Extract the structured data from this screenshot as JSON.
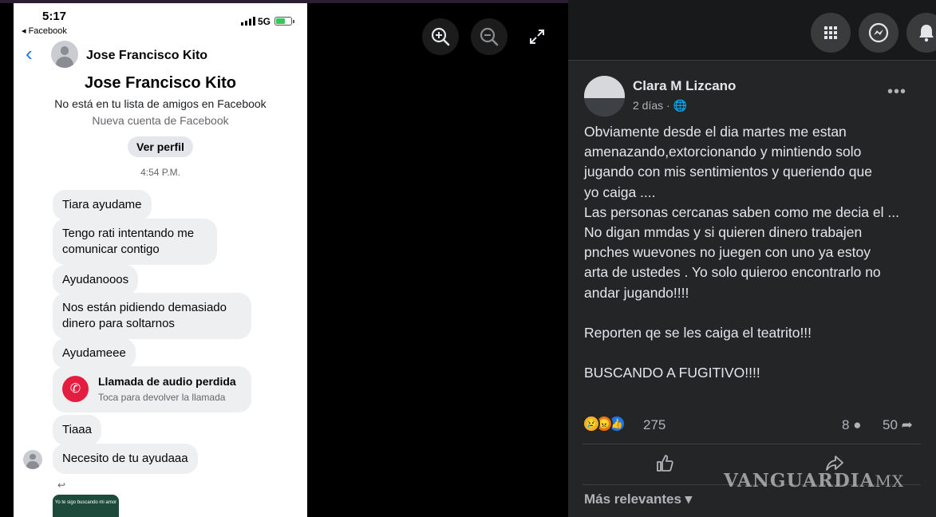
{
  "status_bar": {
    "time": "5:17",
    "back_app": "◂ Facebook",
    "network": "5G"
  },
  "chat": {
    "header_name": "Jose Francisco Kito",
    "profile_name": "Jose Francisco Kito",
    "not_friend_text": "No está en tu lista de amigos en Facebook",
    "new_account_text": "Nueva cuenta de Facebook",
    "view_profile_label": "Ver perfil",
    "timestamp": "4:54 P.M.",
    "messages": [
      "Tiara ayudame",
      "Tengo rati intentando me comunicar contigo",
      "Ayudanooos",
      "Nos están pidiendo demasiado dinero para soltarnos",
      "Ayudameee",
      "Tiaaa",
      "Necesito de tu ayudaaa"
    ],
    "missed_call_title": "Llamada de audio perdida",
    "missed_call_subtitle": "Toca para devolver la llamada",
    "story_text": "Yo te sigo buscando mi amor"
  },
  "post": {
    "author": "Clara M Lizcano",
    "meta": "2 días · 🌐",
    "body_lines": [
      "Obviamente desde el dia martes me estan",
      "amenazando,extorcionando y mintiendo solo",
      "jugando con mis sentimientos y queriendo que",
      "yo caiga ....",
      "Las personas cercanas saben como me decia el ...",
      "No digan mmdas y si quieren dinero trabajen",
      "pnches wuevones no juegen con uno ya estoy",
      "arta de ustedes . Yo solo quieroo encontrarlo no",
      "andar jugando!!!!",
      "",
      "Reporten qe se les caiga el teatrito!!!",
      "",
      "BUSCANDO A FUGITIVO!!!!"
    ],
    "reaction_count": "275",
    "comment_count": "8",
    "share_count": "50",
    "sort_label": "Más relevantes"
  },
  "watermark": {
    "brand": "VANGUARDIA",
    "suffix": "MX"
  },
  "icons": {
    "zoom_in": "zoom-in-icon",
    "zoom_out": "zoom-out-icon",
    "expand": "expand-icon",
    "apps": "apps-grid-icon",
    "messenger": "messenger-icon",
    "notifications": "bell-icon"
  },
  "colors": {
    "messenger_blue": "#1877f2",
    "missed_call_red": "#e41e3f",
    "dark_panel": "#242526"
  }
}
